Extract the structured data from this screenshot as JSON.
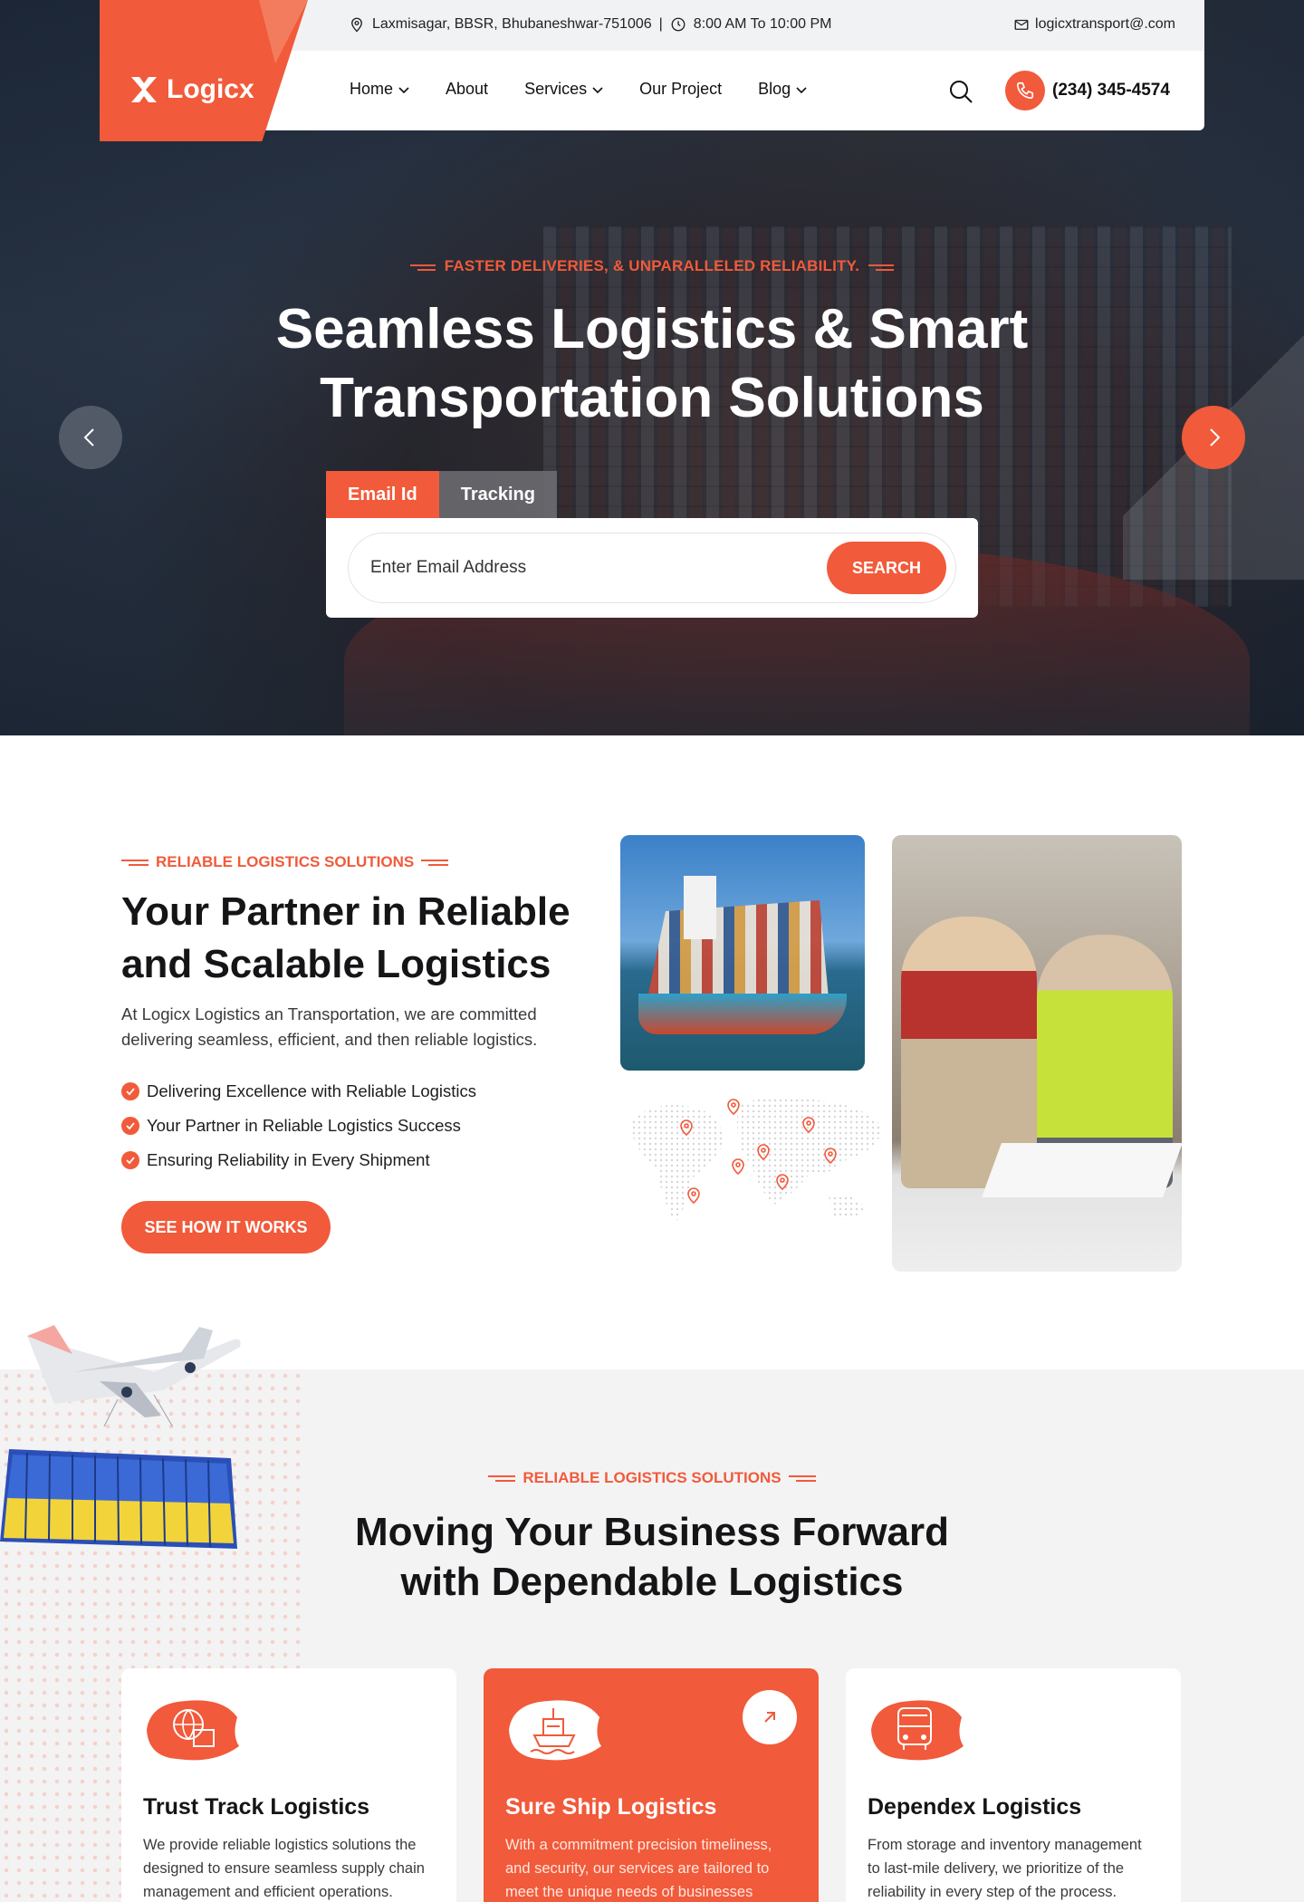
{
  "topbar": {
    "address": "Laxmisagar, BBSR, Bhubaneshwar-751006",
    "separator": "|",
    "hours": "8:00 AM To 10:00 PM",
    "email": "logicxtransport@.com"
  },
  "brand": {
    "name": "Logicx",
    "color": "#f15a3a"
  },
  "nav": {
    "items": [
      {
        "label": "Home",
        "has_dropdown": true
      },
      {
        "label": "About",
        "has_dropdown": false
      },
      {
        "label": "Services",
        "has_dropdown": true
      },
      {
        "label": "Our Project",
        "has_dropdown": false
      },
      {
        "label": "Blog",
        "has_dropdown": true
      }
    ],
    "phone": "(234) 345-4574"
  },
  "hero": {
    "tagline": "FASTER DELIVERIES, & UNPARALLELED RELIABILITY.",
    "title_line1": "Seamless Logistics & Smart",
    "title_line2": "Transportation Solutions",
    "tabs": [
      {
        "label": "Email Id",
        "active": true
      },
      {
        "label": "Tracking",
        "active": false
      }
    ],
    "search_placeholder": "Enter Email Address",
    "search_button": "SEARCH"
  },
  "about": {
    "label": "RELIABLE LOGISTICS SOLUTIONS",
    "title_line1": "Your Partner in Reliable",
    "title_line2": "and Scalable Logistics",
    "desc_line1": "At Logicx Logistics an Transportation, we are committed",
    "desc_line2": "delivering seamless, efficient, and then reliable logistics.",
    "checks": [
      "Delivering Excellence with Reliable Logistics",
      "Your Partner in Reliable Logistics Success",
      "Ensuring Reliability in Every Shipment"
    ],
    "cta": "SEE HOW IT WORKS"
  },
  "services": {
    "label": "RELIABLE LOGISTICS SOLUTIONS",
    "title_line1": "Moving Your Business Forward",
    "title_line2": "with Dependable Logistics",
    "cards": [
      {
        "title": "Trust Track Logistics",
        "icon": "globe-box-icon",
        "desc_lines": [
          "We provide reliable logistics solutions the",
          "designed to ensure seamless supply chain",
          "management and efficient operations."
        ]
      },
      {
        "title": "Sure Ship Logistics",
        "icon": "ship-icon",
        "highlighted": true,
        "desc_lines": [
          "With a commitment precision timeliness,",
          "and security, our services are tailored to",
          "meet the unique needs of businesses"
        ]
      },
      {
        "title": "Dependex Logistics",
        "icon": "bus-icon",
        "desc_lines": [
          "From storage and inventory management",
          "to last-mile delivery, we prioritize of the",
          "reliability in every step of the process."
        ]
      }
    ]
  }
}
